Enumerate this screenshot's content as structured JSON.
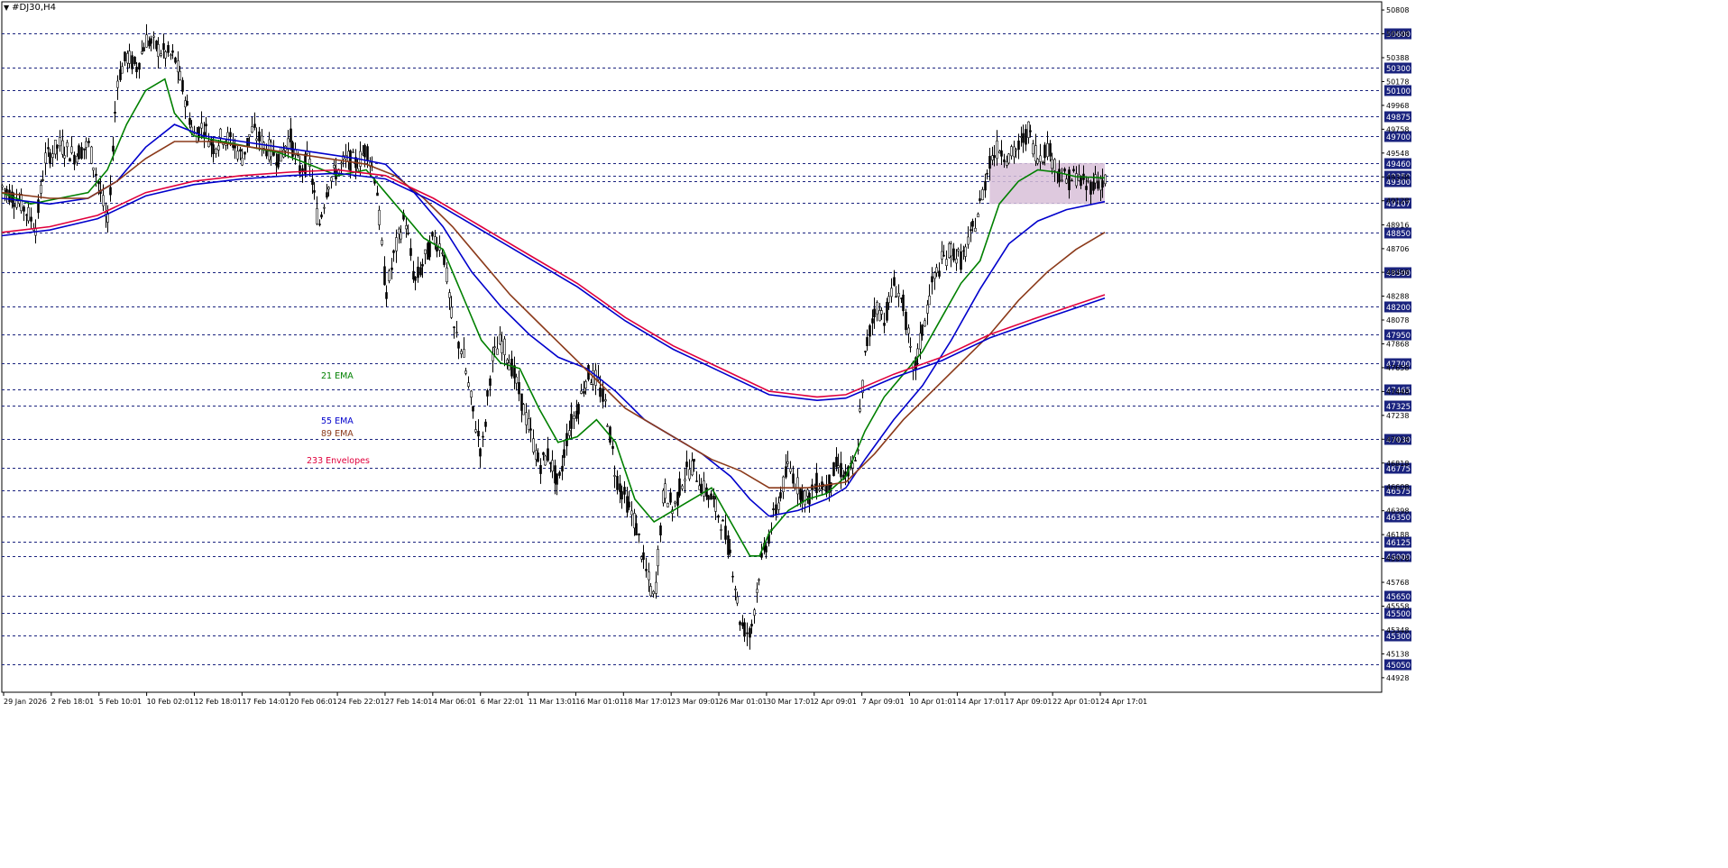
{
  "window": {
    "symbol_title": "#DJ30,H4"
  },
  "chart_data": {
    "type": "candlestick",
    "title": "#DJ30,H4",
    "ylim": [
      44800,
      50880
    ],
    "y_tick_labels": [
      "50808",
      "50598",
      "50388",
      "50178",
      "49968",
      "49758",
      "49548",
      "49338",
      "49128",
      "48916",
      "48706",
      "48498",
      "48288",
      "48078",
      "47868",
      "47658",
      "47448",
      "47238",
      "47028",
      "46818",
      "46608",
      "46398",
      "46188",
      "45978",
      "45768",
      "45558",
      "45348",
      "45138",
      "44928"
    ],
    "y_level_labels": [
      "50600",
      "50300",
      "50100",
      "49875",
      "49700",
      "49460",
      "49350",
      "49300",
      "49107",
      "48850",
      "48500",
      "48200",
      "47950",
      "47700",
      "47465",
      "47325",
      "47030",
      "46775",
      "46575",
      "46350",
      "46125",
      "46000",
      "45650",
      "45500",
      "45300",
      "45050"
    ],
    "x_tick_labels": [
      "29 Jan 2026",
      "2 Feb 18:01",
      "5 Feb 10:01",
      "10 Feb 02:01",
      "12 Feb 18:01",
      "17 Feb 14:01",
      "20 Feb 06:01",
      "24 Feb 22:01",
      "27 Feb 14:01",
      "4 Mar 06:01",
      "6 Mar 22:01",
      "11 Mar 13:01",
      "16 Mar 01:01",
      "18 Mar 17:01",
      "23 Mar 09:01",
      "26 Mar 01:01",
      "30 Mar 17:01",
      "2 Apr 09:01",
      "7 Apr 09:01",
      "10 Apr 01:01",
      "14 Apr 17:01",
      "17 Apr 09:01",
      "22 Apr 01:01",
      "24 Apr 17:01"
    ],
    "x_range": [
      0,
      230
    ],
    "price_path": [
      [
        0,
        49250
      ],
      [
        4,
        49100
      ],
      [
        7,
        48900
      ],
      [
        9,
        49500
      ],
      [
        12,
        49620
      ],
      [
        15,
        49530
      ],
      [
        18,
        49620
      ],
      [
        20,
        49300
      ],
      [
        22,
        48900
      ],
      [
        24,
        50200
      ],
      [
        26,
        50400
      ],
      [
        28,
        50300
      ],
      [
        30,
        50550
      ],
      [
        33,
        50450
      ],
      [
        36,
        50380
      ],
      [
        38,
        50050
      ],
      [
        40,
        49700
      ],
      [
        42,
        49800
      ],
      [
        44,
        49600
      ],
      [
        46,
        49700
      ],
      [
        48,
        49650
      ],
      [
        50,
        49500
      ],
      [
        52,
        49750
      ],
      [
        55,
        49600
      ],
      [
        58,
        49500
      ],
      [
        60,
        49700
      ],
      [
        62,
        49400
      ],
      [
        64,
        49500
      ],
      [
        66,
        48900
      ],
      [
        68,
        49300
      ],
      [
        70,
        49400
      ],
      [
        72,
        49500
      ],
      [
        74,
        49450
      ],
      [
        76,
        49600
      ],
      [
        78,
        49300
      ],
      [
        80,
        48300
      ],
      [
        82,
        48700
      ],
      [
        84,
        49000
      ],
      [
        86,
        48400
      ],
      [
        88,
        48600
      ],
      [
        90,
        48800
      ],
      [
        92,
        48700
      ],
      [
        94,
        48000
      ],
      [
        96,
        47800
      ],
      [
        98,
        47300
      ],
      [
        100,
        46900
      ],
      [
        102,
        47700
      ],
      [
        104,
        47900
      ],
      [
        106,
        47700
      ],
      [
        108,
        47400
      ],
      [
        110,
        47100
      ],
      [
        112,
        46800
      ],
      [
        114,
        46900
      ],
      [
        116,
        46600
      ],
      [
        118,
        47100
      ],
      [
        120,
        47300
      ],
      [
        122,
        47600
      ],
      [
        124,
        47550
      ],
      [
        126,
        47300
      ],
      [
        128,
        46700
      ],
      [
        130,
        46500
      ],
      [
        132,
        46300
      ],
      [
        134,
        45900
      ],
      [
        136,
        45600
      ],
      [
        138,
        46600
      ],
      [
        140,
        46400
      ],
      [
        142,
        46700
      ],
      [
        144,
        46800
      ],
      [
        146,
        46600
      ],
      [
        148,
        46500
      ],
      [
        150,
        46300
      ],
      [
        152,
        46000
      ],
      [
        154,
        45400
      ],
      [
        156,
        45300
      ],
      [
        158,
        45900
      ],
      [
        160,
        46200
      ],
      [
        162,
        46500
      ],
      [
        164,
        46800
      ],
      [
        166,
        46600
      ],
      [
        168,
        46500
      ],
      [
        170,
        46650
      ],
      [
        172,
        46600
      ],
      [
        174,
        46800
      ],
      [
        176,
        46700
      ],
      [
        178,
        46800
      ],
      [
        180,
        47800
      ],
      [
        182,
        48200
      ],
      [
        184,
        48100
      ],
      [
        186,
        48400
      ],
      [
        188,
        48200
      ],
      [
        190,
        47600
      ],
      [
        192,
        48000
      ],
      [
        194,
        48400
      ],
      [
        196,
        48600
      ],
      [
        198,
        48700
      ],
      [
        200,
        48600
      ],
      [
        202,
        48800
      ],
      [
        204,
        49100
      ],
      [
        206,
        49500
      ],
      [
        208,
        49600
      ],
      [
        210,
        49500
      ],
      [
        212,
        49600
      ],
      [
        214,
        49750
      ],
      [
        216,
        49500
      ],
      [
        218,
        49600
      ],
      [
        220,
        49400
      ],
      [
        222,
        49300
      ],
      [
        224,
        49350
      ],
      [
        226,
        49250
      ],
      [
        228,
        49300
      ],
      [
        230,
        49300
      ]
    ],
    "series": [
      {
        "name": "21 EMA",
        "color": "#008000",
        "points": [
          [
            0,
            49200
          ],
          [
            6,
            49100
          ],
          [
            12,
            49150
          ],
          [
            18,
            49200
          ],
          [
            22,
            49400
          ],
          [
            26,
            49800
          ],
          [
            30,
            50100
          ],
          [
            34,
            50200
          ],
          [
            36,
            49900
          ],
          [
            40,
            49700
          ],
          [
            46,
            49650
          ],
          [
            52,
            49600
          ],
          [
            58,
            49550
          ],
          [
            64,
            49450
          ],
          [
            70,
            49350
          ],
          [
            76,
            49400
          ],
          [
            80,
            49200
          ],
          [
            84,
            49000
          ],
          [
            88,
            48800
          ],
          [
            92,
            48700
          ],
          [
            96,
            48300
          ],
          [
            100,
            47900
          ],
          [
            104,
            47700
          ],
          [
            108,
            47650
          ],
          [
            112,
            47300
          ],
          [
            116,
            47000
          ],
          [
            120,
            47050
          ],
          [
            124,
            47200
          ],
          [
            128,
            47000
          ],
          [
            132,
            46500
          ],
          [
            136,
            46300
          ],
          [
            140,
            46400
          ],
          [
            144,
            46500
          ],
          [
            148,
            46600
          ],
          [
            152,
            46300
          ],
          [
            156,
            46000
          ],
          [
            158,
            46000
          ],
          [
            160,
            46200
          ],
          [
            164,
            46400
          ],
          [
            168,
            46500
          ],
          [
            172,
            46550
          ],
          [
            176,
            46700
          ],
          [
            180,
            47100
          ],
          [
            184,
            47400
          ],
          [
            188,
            47600
          ],
          [
            192,
            47800
          ],
          [
            196,
            48100
          ],
          [
            200,
            48400
          ],
          [
            204,
            48600
          ],
          [
            208,
            49100
          ],
          [
            212,
            49300
          ],
          [
            216,
            49400
          ],
          [
            220,
            49380
          ],
          [
            224,
            49340
          ],
          [
            230,
            49330
          ]
        ]
      },
      {
        "name": "55 EMA",
        "color": "#0000cc",
        "points": [
          [
            0,
            49150
          ],
          [
            10,
            49100
          ],
          [
            18,
            49150
          ],
          [
            24,
            49300
          ],
          [
            30,
            49600
          ],
          [
            36,
            49800
          ],
          [
            42,
            49700
          ],
          [
            50,
            49650
          ],
          [
            58,
            49600
          ],
          [
            66,
            49550
          ],
          [
            74,
            49500
          ],
          [
            80,
            49450
          ],
          [
            86,
            49200
          ],
          [
            92,
            48900
          ],
          [
            98,
            48500
          ],
          [
            104,
            48200
          ],
          [
            110,
            47950
          ],
          [
            116,
            47750
          ],
          [
            122,
            47650
          ],
          [
            128,
            47450
          ],
          [
            134,
            47200
          ],
          [
            140,
            47050
          ],
          [
            146,
            46900
          ],
          [
            152,
            46700
          ],
          [
            156,
            46500
          ],
          [
            160,
            46350
          ],
          [
            166,
            46400
          ],
          [
            172,
            46500
          ],
          [
            176,
            46600
          ],
          [
            180,
            46850
          ],
          [
            186,
            47200
          ],
          [
            192,
            47500
          ],
          [
            198,
            47900
          ],
          [
            204,
            48350
          ],
          [
            210,
            48750
          ],
          [
            216,
            48950
          ],
          [
            222,
            49050
          ],
          [
            230,
            49120
          ]
        ]
      },
      {
        "name": "89 EMA",
        "color": "#8B3A1A",
        "points": [
          [
            0,
            49200
          ],
          [
            10,
            49150
          ],
          [
            18,
            49150
          ],
          [
            24,
            49300
          ],
          [
            30,
            49500
          ],
          [
            36,
            49650
          ],
          [
            44,
            49650
          ],
          [
            52,
            49600
          ],
          [
            60,
            49550
          ],
          [
            68,
            49500
          ],
          [
            76,
            49450
          ],
          [
            82,
            49350
          ],
          [
            88,
            49150
          ],
          [
            94,
            48900
          ],
          [
            100,
            48600
          ],
          [
            106,
            48300
          ],
          [
            112,
            48050
          ],
          [
            118,
            47800
          ],
          [
            124,
            47550
          ],
          [
            130,
            47300
          ],
          [
            136,
            47150
          ],
          [
            142,
            47000
          ],
          [
            148,
            46850
          ],
          [
            154,
            46750
          ],
          [
            160,
            46600
          ],
          [
            168,
            46600
          ],
          [
            176,
            46650
          ],
          [
            182,
            46900
          ],
          [
            188,
            47200
          ],
          [
            194,
            47450
          ],
          [
            200,
            47700
          ],
          [
            206,
            47950
          ],
          [
            212,
            48250
          ],
          [
            218,
            48500
          ],
          [
            224,
            48700
          ],
          [
            230,
            48850
          ]
        ]
      },
      {
        "name": "233 Envelopes",
        "color": "#e0003c",
        "points": [
          [
            0,
            48850
          ],
          [
            10,
            48900
          ],
          [
            20,
            49000
          ],
          [
            30,
            49200
          ],
          [
            40,
            49300
          ],
          [
            50,
            49350
          ],
          [
            60,
            49380
          ],
          [
            70,
            49400
          ],
          [
            80,
            49350
          ],
          [
            90,
            49150
          ],
          [
            100,
            48900
          ],
          [
            110,
            48650
          ],
          [
            120,
            48400
          ],
          [
            130,
            48100
          ],
          [
            140,
            47850
          ],
          [
            150,
            47650
          ],
          [
            160,
            47450
          ],
          [
            170,
            47400
          ],
          [
            176,
            47420
          ],
          [
            186,
            47600
          ],
          [
            196,
            47750
          ],
          [
            206,
            47950
          ],
          [
            216,
            48100
          ],
          [
            230,
            48300
          ]
        ]
      },
      {
        "name": "233 Envelopes",
        "color": "#0000cc",
        "points": [
          [
            0,
            48820
          ],
          [
            10,
            48870
          ],
          [
            20,
            48970
          ],
          [
            30,
            49170
          ],
          [
            40,
            49270
          ],
          [
            50,
            49320
          ],
          [
            60,
            49350
          ],
          [
            70,
            49370
          ],
          [
            80,
            49320
          ],
          [
            90,
            49120
          ],
          [
            100,
            48870
          ],
          [
            110,
            48620
          ],
          [
            120,
            48370
          ],
          [
            130,
            48070
          ],
          [
            140,
            47820
          ],
          [
            150,
            47620
          ],
          [
            160,
            47420
          ],
          [
            170,
            47370
          ],
          [
            176,
            47390
          ],
          [
            186,
            47570
          ],
          [
            196,
            47720
          ],
          [
            206,
            47920
          ],
          [
            216,
            48070
          ],
          [
            230,
            48270
          ]
        ]
      }
    ],
    "annotations": [
      {
        "text": "21 EMA",
        "color": "#008000"
      },
      {
        "text": "55 EMA",
        "color": "#0000cc"
      },
      {
        "text": "89 EMA",
        "color": "#8B3A1A"
      },
      {
        "text": "233 Envelopes",
        "color": "#e0003c"
      }
    ],
    "highlight_zone": {
      "x": [
        206,
        230
      ],
      "y": [
        49100,
        49460
      ],
      "color": "#d8bfd8"
    },
    "grid": false,
    "background": "#ffffff"
  }
}
